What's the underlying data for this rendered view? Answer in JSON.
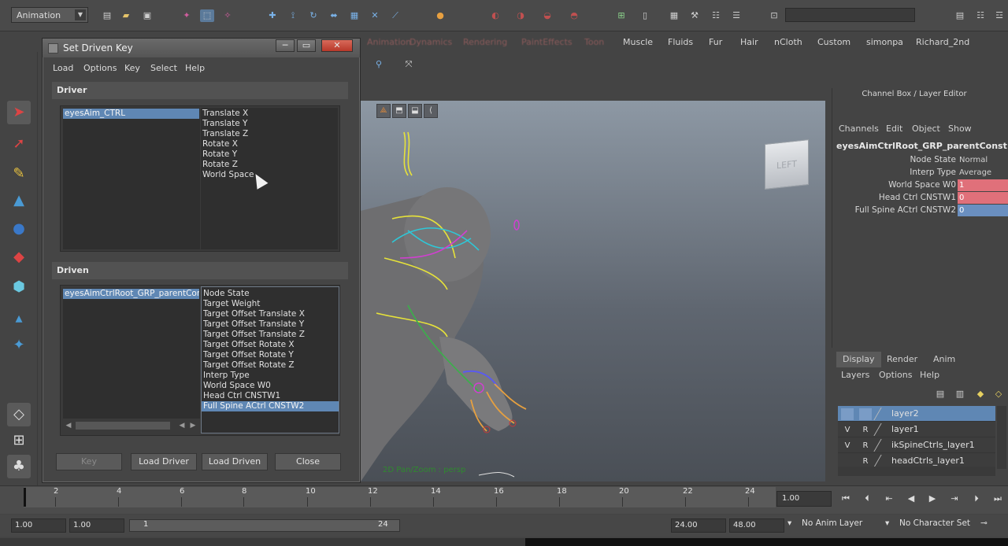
{
  "toolbar": {
    "mode": "Animation"
  },
  "shelf_tabs": {
    "dim": [
      "Animation",
      "Dynamics",
      "Rendering",
      "PaintEffects",
      "Toon"
    ],
    "items": [
      "Muscle",
      "Fluids",
      "Fur",
      "Hair",
      "nCloth",
      "Custom",
      "simonpa",
      "Richard_2nd"
    ]
  },
  "sdk": {
    "title": "Set Driven Key",
    "menus": [
      "Load",
      "Options",
      "Key",
      "Select",
      "Help"
    ],
    "driver": {
      "header": "Driver",
      "objects": [
        "eyesAim_CTRL"
      ],
      "attributes": [
        "Translate X",
        "Translate Y",
        "Translate Z",
        "Rotate X",
        "Rotate Y",
        "Rotate Z",
        "World Space"
      ]
    },
    "driven": {
      "header": "Driven",
      "objects": [
        "eyesAimCtrlRoot_GRP_parentConst"
      ],
      "attributes": [
        "Node State",
        "Target Weight",
        "Target Offset Translate X",
        "Target Offset Translate Y",
        "Target Offset Translate Z",
        "Target Offset Rotate X",
        "Target Offset Rotate Y",
        "Target Offset Rotate Z",
        "Interp Type",
        "World Space W0",
        "Head Ctrl CNSTW1",
        "Full Spine ACtrl CNSTW2"
      ],
      "selected_attribute_index": 11
    },
    "buttons": {
      "key": "Key",
      "load_driver": "Load Driver",
      "load_driven": "Load Driven",
      "close": "Close"
    }
  },
  "viewport": {
    "viewcube_label": "LEFT",
    "status_label": "2D Pan/Zoom : persp"
  },
  "channel_box": {
    "title": "Channel Box / Layer Editor",
    "menus": [
      "Channels",
      "Edit",
      "Object",
      "Show"
    ],
    "node": "eyesAimCtrlRoot_GRP_parentConst...",
    "rows": [
      {
        "label": "Node State",
        "value": "Normal",
        "color": ""
      },
      {
        "label": "Interp Type",
        "value": "Average",
        "color": ""
      },
      {
        "label": "World Space W0",
        "value": "1",
        "color": "#e0707a"
      },
      {
        "label": "Head Ctrl CNSTW1",
        "value": "0",
        "color": "#e0707a"
      },
      {
        "label": "Full Spine ACtrl CNSTW2",
        "value": "0",
        "color": "#6a8fc0"
      }
    ]
  },
  "layer_editor": {
    "tabs": [
      "Display",
      "Render",
      "Anim"
    ],
    "menus": [
      "Layers",
      "Options",
      "Help"
    ],
    "layers": [
      {
        "v": "",
        "r": "",
        "name": "layer2",
        "selected": true
      },
      {
        "v": "V",
        "r": "R",
        "name": "layer1",
        "selected": false
      },
      {
        "v": "V",
        "r": "R",
        "name": "ikSpineCtrls_layer1",
        "selected": false
      },
      {
        "v": "",
        "r": "R",
        "name": "headCtrls_layer1",
        "selected": false
      }
    ]
  },
  "timeline": {
    "ticks": [
      "2",
      "4",
      "6",
      "8",
      "10",
      "12",
      "14",
      "16",
      "18",
      "20",
      "22",
      "24"
    ],
    "current_frame": "1.00"
  },
  "range": {
    "start": "1.00",
    "anim_start": "1.00",
    "range_start": "1",
    "range_end": "24",
    "anim_end": "24.00",
    "end": "48.00",
    "anim_layer": "No Anim Layer",
    "character_set": "No Character Set"
  },
  "colors": {
    "selection": "#5f87b4",
    "close_button": "#c84a3a",
    "viewport_top": "#8d98a4"
  }
}
